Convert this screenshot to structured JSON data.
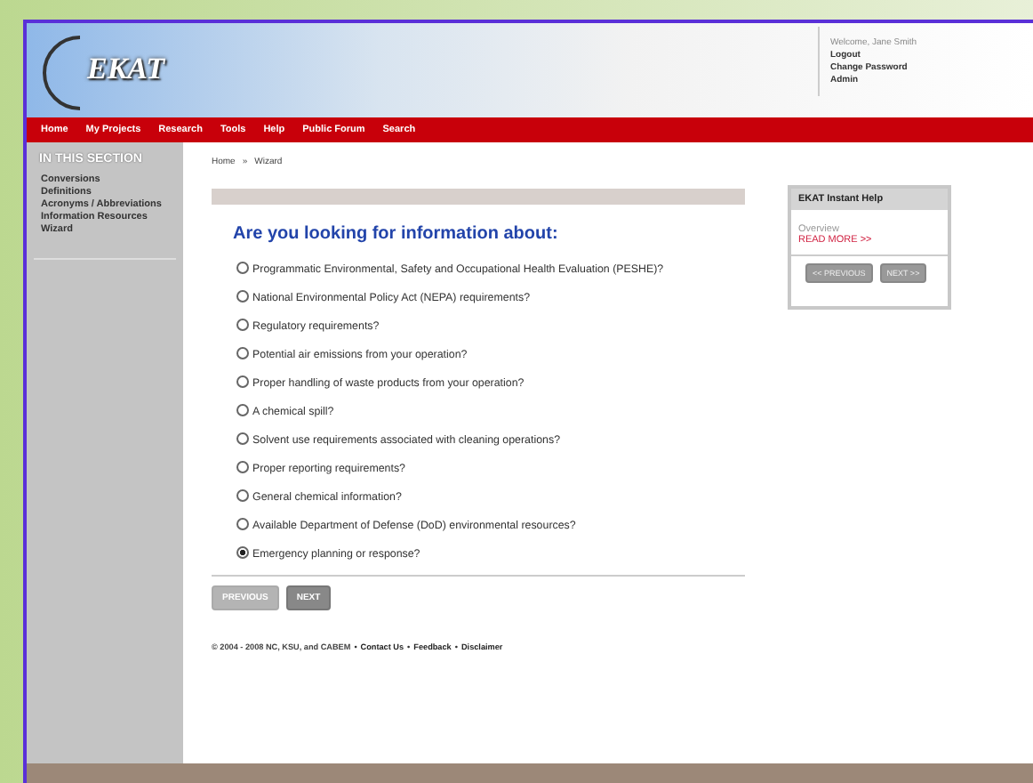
{
  "header": {
    "logo": "EKAT",
    "user_links": [
      {
        "label": "Welcome, Jane Smith",
        "kind": "text"
      },
      {
        "label": "Logout",
        "kind": "link"
      },
      {
        "label": "Change Password",
        "kind": "link"
      },
      {
        "label": "Admin",
        "kind": "link"
      }
    ]
  },
  "nav": [
    "Home",
    "My Projects",
    "Research",
    "Tools",
    "Help",
    "Public Forum",
    "Search"
  ],
  "sidebar": {
    "title": "IN THIS SECTION",
    "items": [
      "Conversions",
      "Definitions",
      "Acronyms / Abbreviations",
      "Information Resources",
      "Wizard"
    ]
  },
  "breadcrumb": [
    "Home",
    "»",
    "Wizard"
  ],
  "question": "Are you looking for information about:",
  "options": [
    {
      "label": "Programmatic Environmental, Safety and Occupational Health Evaluation (PESHE)?",
      "selected": false
    },
    {
      "label": "National Environmental Policy Act (NEPA) requirements?",
      "selected": false
    },
    {
      "label": "Regulatory requirements?",
      "selected": false
    },
    {
      "label": "Potential air emissions from your operation?",
      "selected": false
    },
    {
      "label": "Proper handling of waste products from your operation?",
      "selected": false
    },
    {
      "label": "A chemical spill?",
      "selected": false
    },
    {
      "label": "Solvent use requirements associated with cleaning operations?",
      "selected": false
    },
    {
      "label": "Proper reporting requirements?",
      "selected": false
    },
    {
      "label": "General chemical information?",
      "selected": false
    },
    {
      "label": "Available Department of Defense (DoD) environmental resources?",
      "selected": false
    },
    {
      "label": "Emergency planning or response?",
      "selected": true
    }
  ],
  "wizard_buttons": [
    {
      "label": "PREVIOUS",
      "disabled": true
    },
    {
      "label": "NEXT",
      "disabled": false
    }
  ],
  "footer": [
    {
      "label": "© 2004 - 2008 NC, KSU, and CABEM",
      "kind": "text"
    },
    {
      "label": "•",
      "kind": "separator"
    },
    {
      "label": "Contact Us",
      "kind": "link"
    },
    {
      "label": "•",
      "kind": "separator"
    },
    {
      "label": "Feedback",
      "kind": "link"
    },
    {
      "label": "•",
      "kind": "separator"
    },
    {
      "label": "Disclaimer",
      "kind": "link"
    }
  ],
  "help": {
    "title": "EKAT Instant Help",
    "text": "Overview",
    "link": "READ MORE >>",
    "buttons": [
      "<< PREVIOUS",
      "NEXT >>"
    ]
  }
}
